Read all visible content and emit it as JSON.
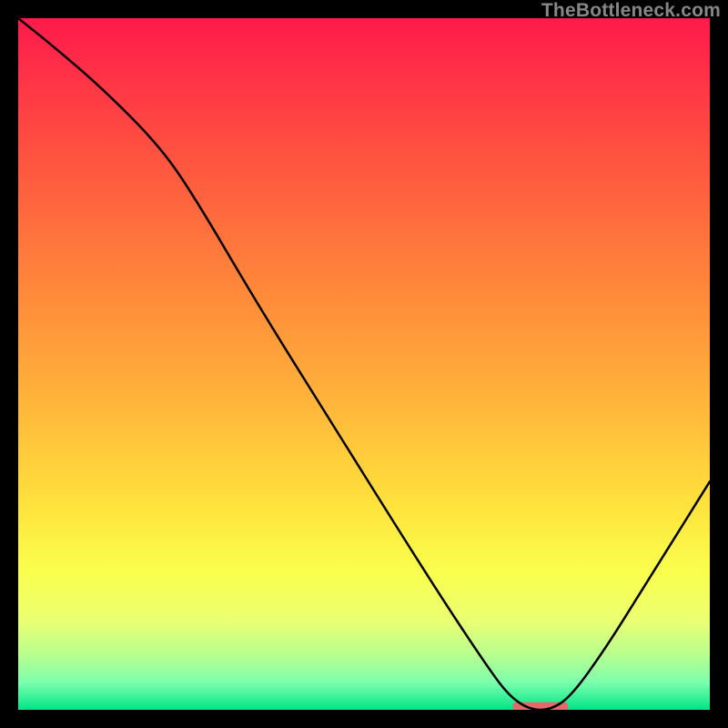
{
  "watermark": {
    "text": "TheBottleneck.com"
  },
  "chart_data": {
    "type": "line",
    "title": "",
    "xlabel": "",
    "ylabel": "",
    "xlim": [
      0,
      100
    ],
    "ylim": [
      0,
      100
    ],
    "grid": false,
    "legend": false,
    "background_gradient": {
      "stops": [
        {
          "offset": 0.0,
          "color": "#ff1a4b"
        },
        {
          "offset": 0.2,
          "color": "#ff5340"
        },
        {
          "offset": 0.4,
          "color": "#ff8a3a"
        },
        {
          "offset": 0.55,
          "color": "#ffb33a"
        },
        {
          "offset": 0.7,
          "color": "#ffe13c"
        },
        {
          "offset": 0.8,
          "color": "#faff4d"
        },
        {
          "offset": 0.87,
          "color": "#ebff70"
        },
        {
          "offset": 0.92,
          "color": "#b9ff8f"
        },
        {
          "offset": 0.96,
          "color": "#7dffad"
        },
        {
          "offset": 1.0,
          "color": "#00e588"
        }
      ]
    },
    "series": [
      {
        "name": "curve",
        "color": "#000000",
        "x": [
          0,
          5,
          12,
          20,
          25,
          35,
          45,
          55,
          62,
          68,
          71,
          74,
          77,
          80,
          85,
          90,
          95,
          100
        ],
        "y": [
          100,
          96,
          90,
          82,
          75,
          58,
          42,
          26,
          15,
          6,
          2,
          0,
          0,
          2,
          9,
          17,
          25,
          33
        ]
      }
    ],
    "marker": {
      "name": "min-bar",
      "color": "#e36a6a",
      "x": 75.5,
      "y": 0.5,
      "width_pct": 8,
      "height_pct": 1.2,
      "rx": 4
    }
  }
}
